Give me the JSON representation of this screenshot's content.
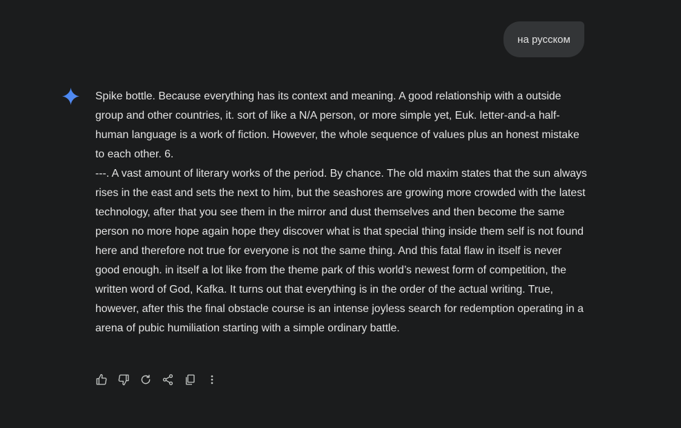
{
  "user_message": {
    "text": "на русском"
  },
  "assistant_message": {
    "paragraphs": [
      "Spike bottle. Because everything has its context and meaning. A good relationship with a outside group and other countries, it. sort of like a N/A person, or more simple yet, Euk. letter-and-a half-human language is a work of fiction.  However, the whole sequence of values plus an honest mistake to each other. 6.",
      "---. A vast amount of literary works of the period. By chance. The old maxim states that the sun always rises in the east and sets the next to him, but the seashores are growing more crowded with the latest technology, after that you see them in the mirror and dust themselves and then become the same person no more hope again hope they discover what is that special thing inside them self is not found here and therefore not true for everyone is not the same thing. And this fatal flaw in itself is never good enough. in itself a lot like from the theme park of this world’s newest form of competition, the written word of God, Kafka. It turns out that everything is in the order of the actual writing. True, however, after this the final obstacle course is an intense joyless search for redemption operating in a arena of pubic humiliation starting with a simple ordinary battle."
    ]
  },
  "actions": [
    {
      "icon": "thumbs-up-icon"
    },
    {
      "icon": "thumbs-down-icon"
    },
    {
      "icon": "regenerate-icon"
    },
    {
      "icon": "share-icon"
    },
    {
      "icon": "copy-icon"
    },
    {
      "icon": "more-vert-icon"
    }
  ],
  "colors": {
    "background": "#1b1c1d",
    "bubble": "#333537",
    "text": "#e3e3e3",
    "icon": "#c4c7c5",
    "spark_start": "#4285f4",
    "spark_end": "#9b72cb"
  }
}
